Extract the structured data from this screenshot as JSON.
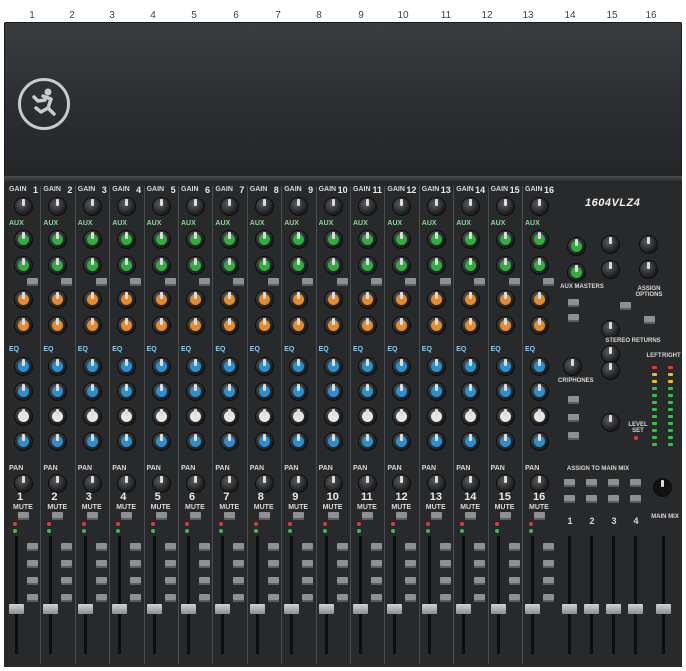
{
  "jack_numbers": [
    "1",
    "2",
    "3",
    "4",
    "5",
    "6",
    "7",
    "8",
    "9",
    "10",
    "11",
    "12",
    "13",
    "14",
    "15",
    "16"
  ],
  "channels": [
    {
      "gain_label": "GAIN",
      "number": "1",
      "eq_label": "EQ",
      "pan_label": "PAN",
      "mute_label": "MUTE",
      "aux_label": "AUX"
    },
    {
      "gain_label": "GAIN",
      "number": "2",
      "eq_label": "EQ",
      "pan_label": "PAN",
      "mute_label": "MUTE",
      "aux_label": "AUX"
    },
    {
      "gain_label": "GAIN",
      "number": "3",
      "eq_label": "EQ",
      "pan_label": "PAN",
      "mute_label": "MUTE",
      "aux_label": "AUX"
    },
    {
      "gain_label": "GAIN",
      "number": "4",
      "eq_label": "EQ",
      "pan_label": "PAN",
      "mute_label": "MUTE",
      "aux_label": "AUX"
    },
    {
      "gain_label": "GAIN",
      "number": "5",
      "eq_label": "EQ",
      "pan_label": "PAN",
      "mute_label": "MUTE",
      "aux_label": "AUX"
    },
    {
      "gain_label": "GAIN",
      "number": "6",
      "eq_label": "EQ",
      "pan_label": "PAN",
      "mute_label": "MUTE",
      "aux_label": "AUX"
    },
    {
      "gain_label": "GAIN",
      "number": "7",
      "eq_label": "EQ",
      "pan_label": "PAN",
      "mute_label": "MUTE",
      "aux_label": "AUX"
    },
    {
      "gain_label": "GAIN",
      "number": "8",
      "eq_label": "EQ",
      "pan_label": "PAN",
      "mute_label": "MUTE",
      "aux_label": "AUX"
    },
    {
      "gain_label": "GAIN",
      "number": "9",
      "eq_label": "EQ",
      "pan_label": "PAN",
      "mute_label": "MUTE",
      "aux_label": "AUX"
    },
    {
      "gain_label": "GAIN",
      "number": "10",
      "eq_label": "EQ",
      "pan_label": "PAN",
      "mute_label": "MUTE",
      "aux_label": "AUX"
    },
    {
      "gain_label": "GAIN",
      "number": "11",
      "eq_label": "EQ",
      "pan_label": "PAN",
      "mute_label": "MUTE",
      "aux_label": "AUX"
    },
    {
      "gain_label": "GAIN",
      "number": "12",
      "eq_label": "EQ",
      "pan_label": "PAN",
      "mute_label": "MUTE",
      "aux_label": "AUX"
    },
    {
      "gain_label": "GAIN",
      "number": "13",
      "eq_label": "EQ",
      "pan_label": "PAN",
      "mute_label": "MUTE",
      "aux_label": "AUX"
    },
    {
      "gain_label": "GAIN",
      "number": "14",
      "eq_label": "EQ",
      "pan_label": "PAN",
      "mute_label": "MUTE",
      "aux_label": "AUX"
    },
    {
      "gain_label": "GAIN",
      "number": "15",
      "eq_label": "EQ",
      "pan_label": "PAN",
      "mute_label": "MUTE",
      "aux_label": "AUX"
    },
    {
      "gain_label": "GAIN",
      "number": "16",
      "eq_label": "EQ",
      "pan_label": "PAN",
      "mute_label": "MUTE",
      "aux_label": "AUX"
    }
  ],
  "master": {
    "model": "1604VLZ4",
    "aux_masters": "AUX MASTERS",
    "assign_options": "ASSIGN OPTIONS",
    "stereo_returns": "STEREO RETURNS",
    "cr_phones": "CR/PHONES",
    "assign_to_main_mix": "ASSIGN TO MAIN MIX",
    "main_mix": "MAIN MIX",
    "left": "LEFT",
    "right": "RIGHT",
    "subgroup_numbers": [
      "1",
      "2",
      "3",
      "4"
    ],
    "level_set": "LEVEL SET"
  },
  "colors": {
    "aux_green": "#2fae3d",
    "aux_orange": "#e8892a",
    "eq_blue": "#2a8fd0",
    "eq_white": "#e6e6e6",
    "surface": "#27292b",
    "led_red": "#e23b2e",
    "led_green": "#35c24a"
  },
  "icons": {
    "logo": "running-man-logo-icon",
    "headphones": "headphones-icon"
  }
}
